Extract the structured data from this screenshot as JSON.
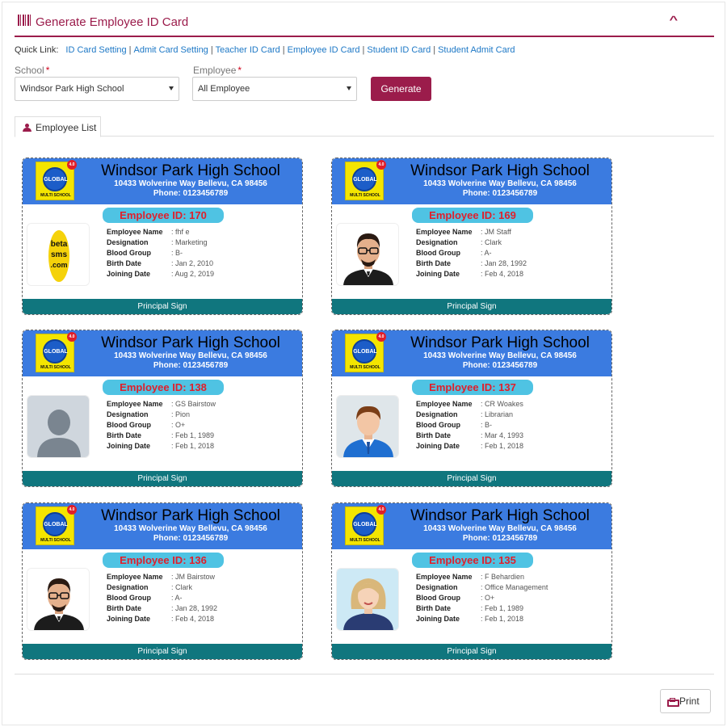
{
  "header": {
    "title": "Generate Employee ID Card",
    "icon": "barcode-icon"
  },
  "quick_links": {
    "label": "Quick Link:",
    "items": [
      "ID Card Setting",
      "Admit Card Setting",
      "Teacher ID Card",
      "Employee ID Card",
      "Student ID Card",
      "Student Admit Card"
    ]
  },
  "form": {
    "school_label": "School",
    "school_value": "Windsor Park High School",
    "employee_label": "Employee",
    "employee_value": "All Employee",
    "required_mark": "*",
    "generate_label": "Generate"
  },
  "tab": {
    "label": "Employee List",
    "icon": "users-icon"
  },
  "card_common": {
    "school": "Windsor Park High School",
    "address": "10433 Wolverine Way Bellevu, CA 98456",
    "phone": "Phone: 0123456789",
    "logo_text": "GLOBAL",
    "logo_caption": "MULTI SCHOOL",
    "logo_badge": "4.0",
    "labels": [
      "Employee Name",
      "Designation",
      "Blood Group",
      "Birth Date",
      "Joining Date"
    ],
    "footer": "Principal Sign"
  },
  "cards": [
    {
      "id": "Employee ID: 170",
      "photo": "beta-sms-logo",
      "values": [
        ": fhf e",
        ": Marketing",
        ": B-",
        ": Jan 2, 2010",
        ": Aug 2, 2019"
      ]
    },
    {
      "id": "Employee ID: 169",
      "photo": "bearded-man-avatar",
      "values": [
        ": JM Staff",
        ": Clark",
        ": A-",
        ": Jan 28, 1992",
        ": Feb 4, 2018"
      ]
    },
    {
      "id": "Employee ID: 138",
      "photo": "default-avatar",
      "values": [
        ": GS Bairstow",
        ": Pion",
        ": O+",
        ": Feb 1, 1989",
        ": Feb 1, 2018"
      ]
    },
    {
      "id": "Employee ID: 137",
      "photo": "man-suit-avatar",
      "values": [
        ": CR Woakes",
        ": Librarian",
        ": B-",
        ": Mar 4, 1993",
        ": Feb 1, 2018"
      ]
    },
    {
      "id": "Employee ID: 136",
      "photo": "bearded-man-avatar",
      "values": [
        ": JM Bairstow",
        ": Clark",
        ": A-",
        ": Jan 28, 1992",
        ": Feb 4, 2018"
      ]
    },
    {
      "id": "Employee ID: 135",
      "photo": "woman-avatar",
      "values": [
        ": F Behardien",
        ": Office Management",
        ": O+",
        ": Feb 1, 1989",
        ": Feb 1, 2018"
      ]
    }
  ],
  "photo_text": {
    "beta_logo": [
      "beta",
      "sms",
      ".com"
    ]
  },
  "print_label": "Print",
  "colors": {
    "accent": "#9b1c4b",
    "card_header": "#3b7be0",
    "card_footer": "#10767e",
    "id_pill": "#4fc3e3",
    "id_text": "#e01f2b",
    "link": "#1d78c6"
  }
}
